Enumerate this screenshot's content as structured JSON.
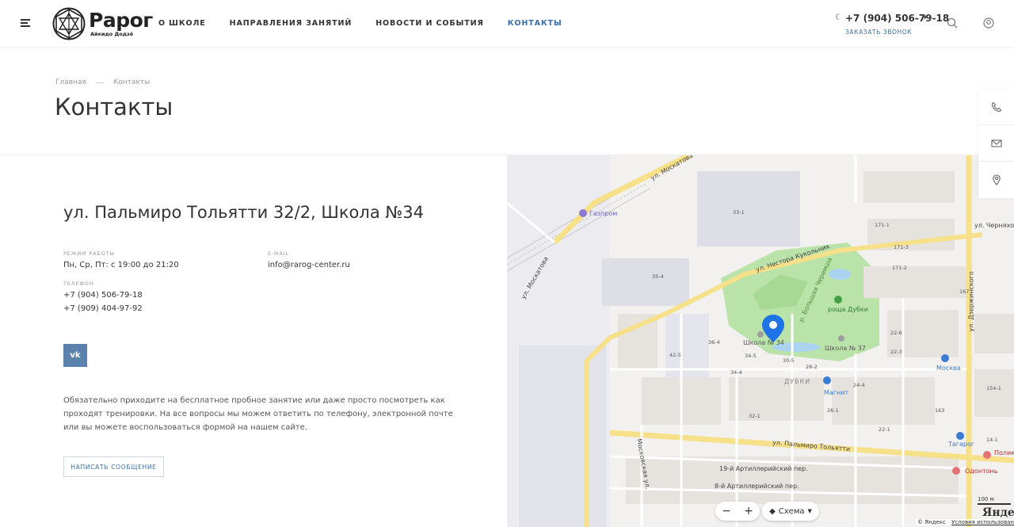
{
  "header": {
    "logo_name": "Рарог",
    "logo_sub": "Айкидо Додзё",
    "nav": [
      "О школе",
      "Направления занятий",
      "Новости и события",
      "Контакты"
    ],
    "active_nav": 3,
    "phone": "+7 (904) 506-79-18",
    "callback": "ЗАКАЗАТЬ ЗВОНОК"
  },
  "breadcrumb": {
    "home": "Главная",
    "current": "Контакты"
  },
  "page_title": "Контакты",
  "info": {
    "address": "ул. Пальмиро Тольятти 32/2, Школа №34",
    "hours_label": "РЕЖИМ РАБОТЫ",
    "hours": "Пн, Ср, Пт: с 19:00 до 21:20",
    "email_label": "E-MAIL",
    "email": "info@rarog-center.ru",
    "phone_label": "ТЕЛЕФОН",
    "phone1": "+7 (904) 506-79-18",
    "phone2": "+7 (909) 404-97-92",
    "vk": "vk",
    "note": "Обязательно приходите на бесплатное пробное занятие или даже просто посмотреть как проходят тренировки. На все вопросы мы можем ответить по телефону, электронной почте или вы можете воспользоваться формой на нашем сайте.",
    "message_button": "НАПИСАТЬ СООБЩЕНИЕ"
  },
  "map": {
    "streets": {
      "moskatova_top": "ул. Москатова",
      "moskatova_left": "ул. Москатова",
      "kukolnik": "ул. Нестора Кукольник",
      "tolyatti": "ул. Пальмиро Тольятти",
      "moskovskaya": "Московская ул.",
      "dzerzhinskogo": "ул. Дзержинского",
      "chernyakhovsky": "ул. Черняховск",
      "artill": "19-й Артиллерийский пер.",
      "artill2": "8-й Артиллерийский пер.",
      "cheremsha": "р. Большая Черемша"
    },
    "pois": {
      "gazprom": "Газпром",
      "school34": "Школа № 34",
      "school37": "Школа № 37",
      "roshcha": "роща Дубки",
      "dubki": "ДУБКИ",
      "magnit": "Магнит",
      "moskva": "Москва",
      "tagarog": "Тагарог",
      "odontone": "Одонтонь",
      "poli": "Полик"
    },
    "houses": [
      "33-1",
      "35-4",
      "36-4",
      "34-5",
      "30-5",
      "28-2",
      "34-4",
      "42-5",
      "22-6",
      "22-3",
      "171-1",
      "171-2",
      "171-3",
      "167",
      "24-4",
      "32-1",
      "26-1",
      "22-1",
      "163",
      "154-1",
      "14-1"
    ],
    "layer_label": "Схема",
    "scale_label": "100 м",
    "brand": "Яндекс",
    "copyright": "© Яндекс",
    "terms": "Условия использования"
  },
  "colors": {
    "accent": "#3a6fa8",
    "park": "#b9e3a8",
    "pin": "#1e73e6",
    "road_yellow": "#f6e08a"
  }
}
